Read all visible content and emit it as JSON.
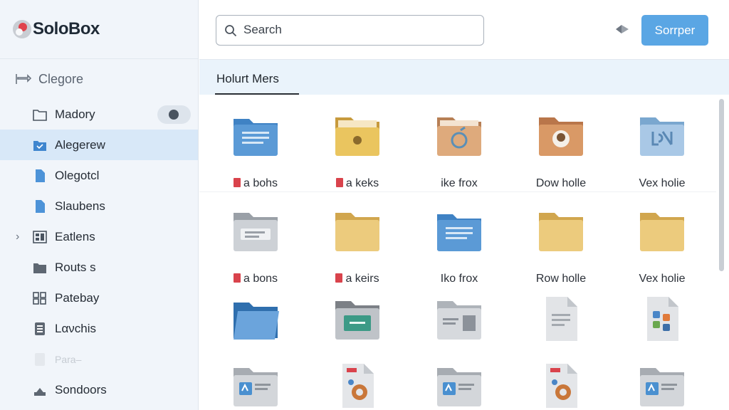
{
  "app": {
    "name": "SoloBox"
  },
  "sidebar": {
    "section": {
      "label": "Clegore",
      "icon": "sync-icon"
    },
    "items": [
      {
        "label": "Madory",
        "icon": "folder-outline-icon",
        "has_badge": true
      },
      {
        "label": "Alegerew",
        "icon": "folder-filled-icon",
        "active": true
      },
      {
        "label": "Olegotcl",
        "icon": "document-icon"
      },
      {
        "label": "Slaubens",
        "icon": "document-icon"
      },
      {
        "label": "Eatlens",
        "icon": "grid-doc-icon",
        "expandable": true
      },
      {
        "label": "Routs s",
        "icon": "folder-dark-icon"
      },
      {
        "label": "Patebay",
        "icon": "grid-icon"
      },
      {
        "label": "Lανchis",
        "icon": "clipboard-icon"
      },
      {
        "label": "Para–",
        "icon": "faded-doc-icon",
        "faded": true
      },
      {
        "label": "Sondoors",
        "icon": "cloud-icon"
      }
    ]
  },
  "search": {
    "placeholder": "Search",
    "value": ""
  },
  "toolbar": {
    "primary_label": "Sorrper",
    "pin_icon": "pin-icon"
  },
  "tabs": [
    {
      "label": "Holurt Mers",
      "active": true
    }
  ],
  "files": {
    "row1": [
      {
        "name": "a bohs",
        "tag": true,
        "icon": "folder-blue-doc"
      },
      {
        "name": "a keks",
        "tag": true,
        "icon": "folder-yellow-dot"
      },
      {
        "name": "ike frox",
        "tag": false,
        "icon": "folder-tan-ring"
      },
      {
        "name": "Dow holle",
        "tag": false,
        "icon": "folder-orange-circle"
      },
      {
        "name": "Vex holie",
        "tag": false,
        "icon": "folder-lightblue-mark"
      }
    ],
    "row2": [
      {
        "name": "a bons",
        "tag": true,
        "icon": "folder-gray-doc"
      },
      {
        "name": "a keirs",
        "tag": true,
        "icon": "folder-yellow"
      },
      {
        "name": "Iko frox",
        "tag": false,
        "icon": "folder-blue-doc"
      },
      {
        "name": "Row holle",
        "tag": false,
        "icon": "folder-yellow"
      },
      {
        "name": "Vex holie",
        "tag": false,
        "icon": "folder-yellow"
      }
    ],
    "row3": [
      {
        "icon": "folder-blue-open"
      },
      {
        "icon": "folder-green-screen"
      },
      {
        "icon": "folder-gray-card"
      },
      {
        "icon": "document-gray"
      },
      {
        "icon": "document-apps"
      }
    ],
    "row4": [
      {
        "icon": "folder-gray-app"
      },
      {
        "icon": "document-gear"
      },
      {
        "icon": "folder-gray-app"
      },
      {
        "icon": "document-gear"
      },
      {
        "icon": "folder-gray-app"
      }
    ]
  },
  "colors": {
    "accent": "#5aa6e4",
    "sidebar_bg": "#f1f5fa",
    "active_item": "#d8e8f8",
    "tab_strip": "#eaf3fb"
  }
}
